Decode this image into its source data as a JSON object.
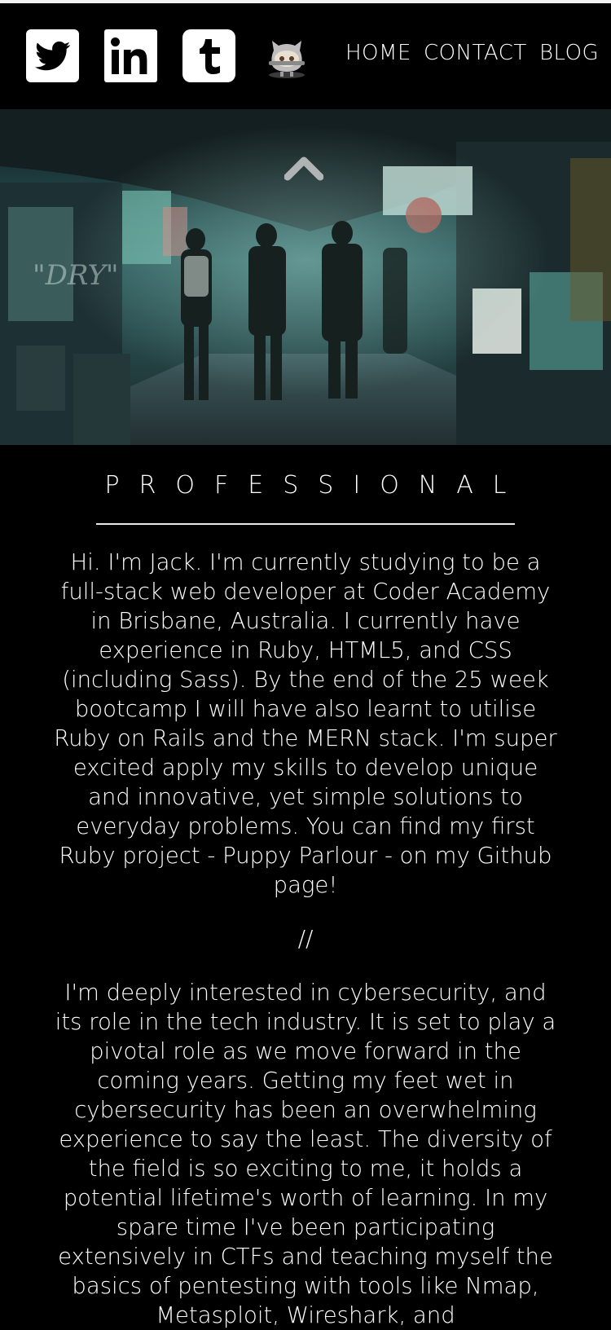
{
  "header": {
    "social": [
      {
        "name": "twitter",
        "icon": "twitter-icon"
      },
      {
        "name": "linkedin",
        "icon": "linkedin-icon",
        "label": "in"
      },
      {
        "name": "tumblr",
        "icon": "tumblr-icon",
        "label": "t"
      },
      {
        "name": "github",
        "icon": "github-octocat-icon"
      }
    ],
    "nav": {
      "home": "HOME",
      "contact": "CONTACT",
      "blog": "BLOG"
    }
  },
  "hero": {
    "icon": "chevron-up-icon",
    "description_colors": {
      "teal": "#5fb8a8",
      "dark": "#0d1a1c"
    }
  },
  "main": {
    "section_title": "PROFESSIONAL",
    "paragraph_1": "Hi. I'm Jack. I'm currently studying to be a full-stack web developer at Coder Academy in Brisbane, Australia. I currently have experience in Ruby, HTML5, and CSS (including Sass). By the end of the 25 week bootcamp I will have also learnt to utilise Ruby on Rails and the MERN stack. I'm super excited apply my skills to develop unique and innovative, yet simple solutions to everyday problems. You can find my first Ruby project - Puppy Parlour - on my Github page!",
    "separator": "//",
    "paragraph_2": "I'm deeply interested in cybersecurity, and its role in the tech industry. It is set to play a pivotal role as we move forward in the coming years. Getting my feet wet in cybersecurity has been an overwhelming experience to say the least. The diversity of the field is so exciting to me, it holds a potential lifetime's worth of learning. In my spare time I've been participating extensively in CTFs and teaching myself the basics of pentesting with tools like Nmap, Metasploit, Wireshark, and"
  }
}
